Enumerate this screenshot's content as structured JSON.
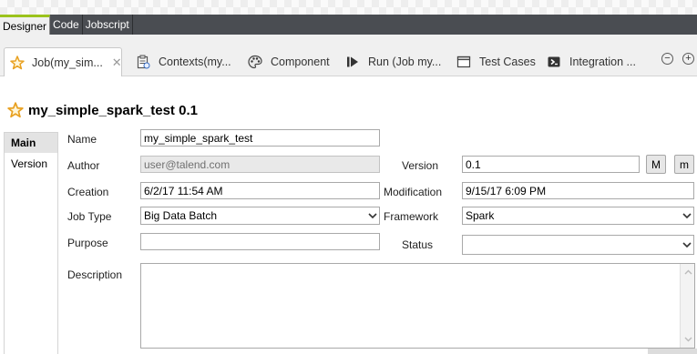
{
  "mode_tabs": [
    {
      "label": "Designer",
      "active": true
    },
    {
      "label": "Code",
      "active": false
    },
    {
      "label": "Jobscript",
      "active": false
    }
  ],
  "editor_tabs": [
    {
      "label": "Job(my_sim...",
      "icon": "job-star-icon",
      "active": true
    },
    {
      "label": "Contexts(my...",
      "icon": "contexts-clipboard-icon",
      "active": false
    },
    {
      "label": "Component",
      "icon": "palette-icon",
      "active": false
    },
    {
      "label": "Run (Job my...",
      "icon": "run-play-icon",
      "active": false
    },
    {
      "label": "Test Cases",
      "icon": "test-cases-window-icon",
      "active": false
    },
    {
      "label": "Integration ...",
      "icon": "integration-arrow-icon",
      "active": false
    }
  ],
  "window_controls": {
    "minimize": "−",
    "maximize": "+"
  },
  "job": {
    "title": "my_simple_spark_test 0.1"
  },
  "side_nav": [
    {
      "label": "Main",
      "active": true
    },
    {
      "label": "Version",
      "active": false
    }
  ],
  "form": {
    "name_label": "Name",
    "name_value": "my_simple_spark_test",
    "author_label": "Author",
    "author_value": "user@talend.com",
    "version_label": "Version",
    "version_value": "0.1",
    "major_button": "M",
    "minor_button": "m",
    "creation_label": "Creation",
    "creation_value": "6/2/17 11:54 AM",
    "modification_label": "Modification",
    "modification_value": "9/15/17 6:09 PM",
    "job_type_label": "Job Type",
    "job_type_value": "Big Data Batch",
    "framework_label": "Framework",
    "framework_value": "Spark",
    "purpose_label": "Purpose",
    "purpose_value": "",
    "status_label": "Status",
    "status_value": "",
    "description_label": "Description",
    "description_value": ""
  },
  "colors": {
    "mode_bar": "#4a4d52",
    "active_accent": "#9bc31c",
    "star": "#e8a020"
  }
}
